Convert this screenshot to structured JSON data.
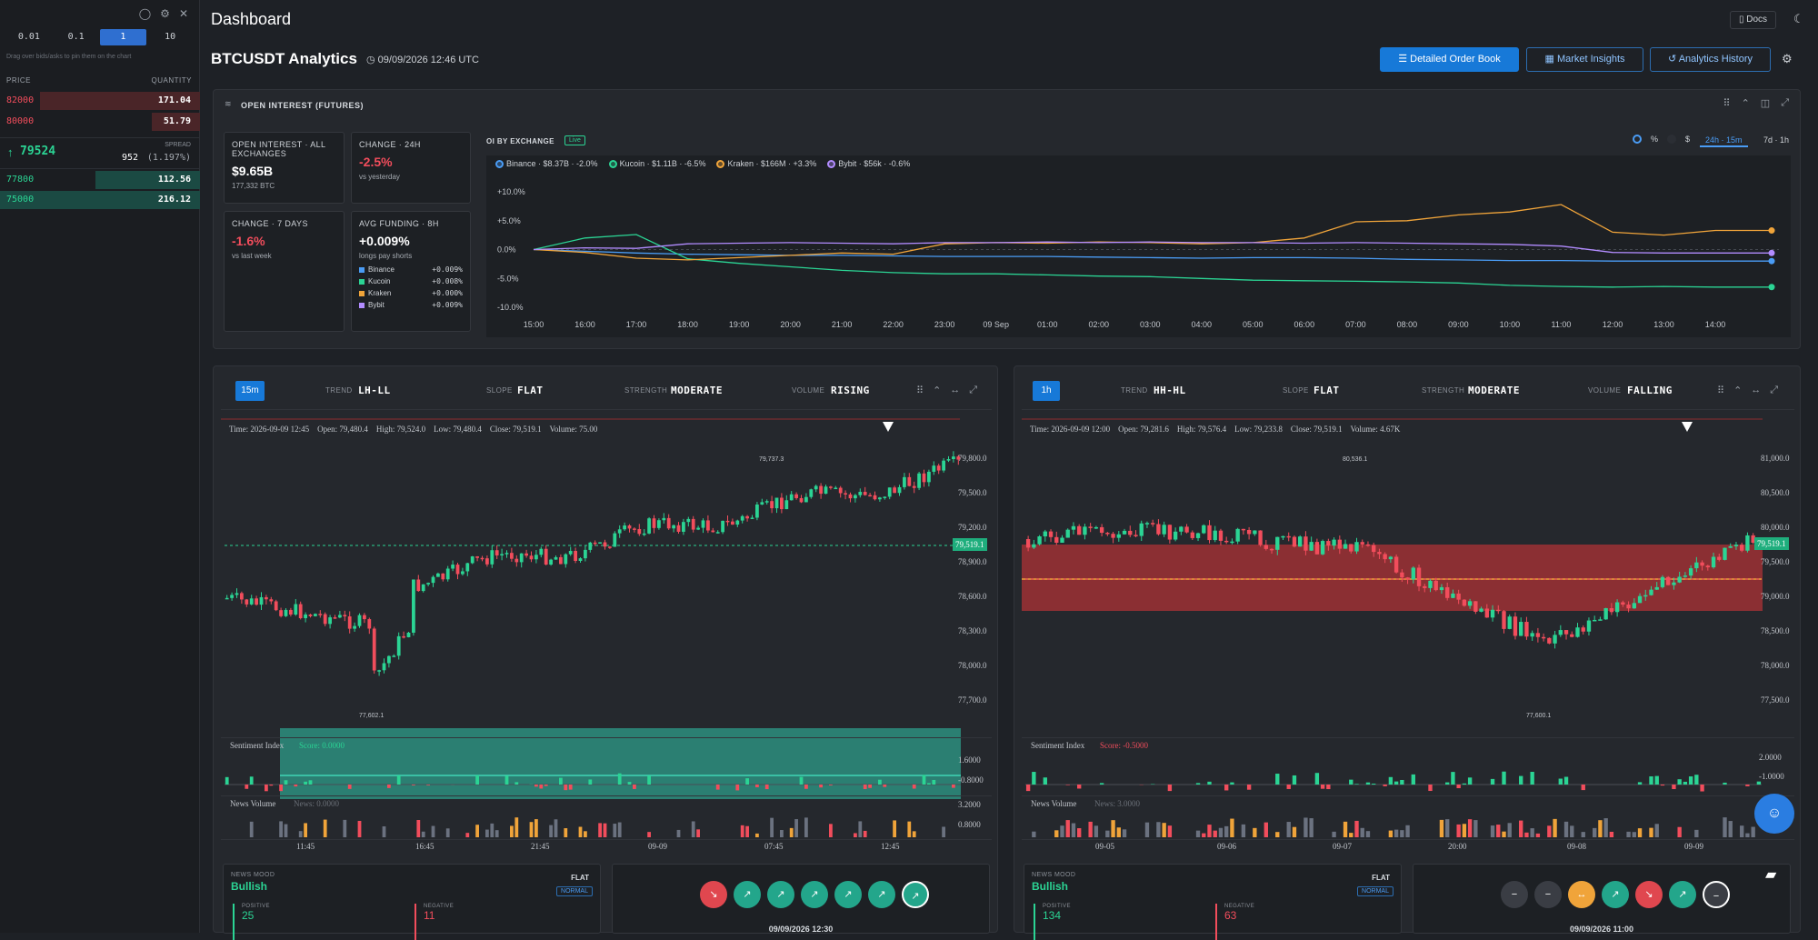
{
  "orderbook": {
    "steps": [
      "0.01",
      "0.1",
      "1",
      "10"
    ],
    "active_step": "1",
    "hint": "Drag over bids/asks to pin them on the chart",
    "price_header": "PRICE",
    "qty_header": "QUANTITY",
    "asks": [
      {
        "price": "82000",
        "qty": "171.04",
        "depth": 0.8
      },
      {
        "price": "80000",
        "qty": "51.79",
        "depth": 0.24
      }
    ],
    "mid": {
      "price": "79524",
      "spread_label": "SPREAD",
      "spread_val": "952",
      "spread_pct": "(1.197%)"
    },
    "bids": [
      {
        "price": "77800",
        "qty": "112.56",
        "depth": 0.52
      },
      {
        "price": "75000",
        "qty": "216.12",
        "depth": 1.0
      }
    ],
    "ask_color": "#f24d5c",
    "bid_color": "#2bd494"
  },
  "header": {
    "title": "Dashboard",
    "docs": "Docs",
    "page_title": "BTCUSDT Analytics",
    "timestamp": "09/09/2026 12:46 UTC",
    "buttons": [
      "Detailed Order Book",
      "Market Insights",
      "Analytics History"
    ]
  },
  "oi": {
    "panel_title": "OPEN INTEREST (FUTURES)",
    "total_label": "OPEN INTEREST · ALL EXCHANGES",
    "total_value": "$9.65B",
    "total_sub": "177,332 BTC",
    "change24_label": "CHANGE · 24H",
    "change24_value": "-2.5%",
    "change24_sub": "vs yesterday",
    "change7_label": "CHANGE · 7 DAYS",
    "change7_value": "-1.6%",
    "change7_sub": "vs last week",
    "funding_label": "AVG FUNDING · 8H",
    "funding_value": "+0.009%",
    "funding_sub": "longs pay shorts",
    "funding_rows": [
      {
        "name": "Binance",
        "value": "+0.009%",
        "color": "#4a9cf5"
      },
      {
        "name": "Kucoin",
        "value": "+0.008%",
        "color": "#2bd494"
      },
      {
        "name": "Kraken",
        "value": "+0.000%",
        "color": "#f0a43a"
      },
      {
        "name": "Bybit",
        "value": "+0.009%",
        "color": "#b28cff"
      }
    ],
    "by_exchange_label": "OI BY EXCHANGE",
    "live": "Live",
    "units": [
      "%",
      "$"
    ],
    "ranges": [
      "24h · 15m",
      "7d · 1h"
    ],
    "legend": [
      {
        "text": "Binance · $8.37B · -2.0%",
        "color": "#4a9cf5"
      },
      {
        "text": "Kucoin · $1.11B · -6.5%",
        "color": "#2bd494"
      },
      {
        "text": "Kraken · $166M · +3.3%",
        "color": "#f0a43a"
      },
      {
        "text": "Bybit · $56k · -0.6%",
        "color": "#b28cff"
      }
    ]
  },
  "chart_data": {
    "type": "line",
    "x": [
      "15:00",
      "16:00",
      "17:00",
      "18:00",
      "19:00",
      "20:00",
      "21:00",
      "22:00",
      "23:00",
      "09 Sep",
      "01:00",
      "02:00",
      "03:00",
      "04:00",
      "05:00",
      "06:00",
      "07:00",
      "08:00",
      "09:00",
      "10:00",
      "11:00",
      "12:00",
      "13:00",
      "14:00"
    ],
    "yticks": [
      "+10.0%",
      "+5.0%",
      "0.0%",
      "-5.0%",
      "-10.0%"
    ],
    "ylim": [
      -10,
      10
    ],
    "series": [
      {
        "name": "Binance",
        "color": "#4a9cf5",
        "values": [
          0,
          -0.3,
          -0.6,
          -0.8,
          -0.9,
          -1.0,
          -1.0,
          -1.1,
          -1.2,
          -1.2,
          -1.2,
          -1.3,
          -1.4,
          -1.5,
          -1.4,
          -1.4,
          -1.5,
          -1.7,
          -1.8,
          -1.9,
          -1.9,
          -2.0,
          -2.0,
          -2.0
        ]
      },
      {
        "name": "Kucoin",
        "color": "#2bd494",
        "values": [
          0,
          2.0,
          2.6,
          -1.6,
          -2.4,
          -3.0,
          -3.6,
          -4.0,
          -4.2,
          -4.2,
          -4.4,
          -4.6,
          -4.7,
          -5.0,
          -5.3,
          -5.4,
          -5.5,
          -5.6,
          -5.8,
          -6.2,
          -6.4,
          -6.5,
          -6.4,
          -6.5
        ]
      },
      {
        "name": "Kraken",
        "color": "#f0a43a",
        "values": [
          0,
          -0.5,
          -1.5,
          -1.8,
          -1.4,
          -1.0,
          -0.6,
          -0.8,
          1.0,
          1.2,
          1.1,
          1.3,
          1.2,
          1.0,
          1.2,
          2.0,
          4.8,
          5.0,
          6.0,
          6.5,
          7.8,
          3.0,
          2.5,
          3.3
        ]
      },
      {
        "name": "Bybit",
        "color": "#b28cff",
        "values": [
          0,
          0.3,
          0.2,
          1.0,
          1.1,
          1.2,
          1.1,
          1.0,
          1.2,
          1.2,
          1.3,
          1.2,
          1.3,
          1.2,
          1.2,
          1.1,
          1.2,
          1.1,
          1.0,
          0.9,
          0.6,
          -0.5,
          -0.6,
          -0.6
        ]
      }
    ]
  },
  "chart_left": {
    "interval": "15m",
    "trend_label": "TREND",
    "trend": "LH-LL",
    "slope_label": "SLOPE",
    "slope": "FLAT",
    "strength_label": "STRENGTH",
    "strength": "MODERATE",
    "volume_label": "VOLUME",
    "volume": "RISING",
    "ohlc": "Time: 2026-09-09 12:45    Open: 79,480.4    High: 79,524.0    Low: 79,480.4    Close: 79,519.1    Volume: 75.00",
    "price_ticks": [
      "79,800.0",
      "79,500.0",
      "79,200.0",
      "78,900.0",
      "78,600.0",
      "78,300.0",
      "78,000.0",
      "77,700.0"
    ],
    "last_price": "79,519.1",
    "high_label": "79,737.3",
    "low_label": "77,602.1",
    "sentiment_label": "Sentiment Index",
    "sentiment_score": "Score: 0.0000",
    "sentiment_ticks": [
      "1.6000",
      "-0.8000"
    ],
    "news_label": "News Volume",
    "news_score": "News: 0.0000",
    "news_ticks": [
      "3.2000",
      "0.8000"
    ],
    "time_ticks": [
      "11:45",
      "16:45",
      "21:45",
      "09-09",
      "07:45",
      "12:45"
    ]
  },
  "chart_right": {
    "interval": "1h",
    "trend_label": "TREND",
    "trend": "HH-HL",
    "slope_label": "SLOPE",
    "slope": "FLAT",
    "strength_label": "STRENGTH",
    "strength": "MODERATE",
    "volume_label": "VOLUME",
    "volume": "FALLING",
    "ohlc": "Time: 2026-09-09 12:00    Open: 79,281.6    High: 79,576.4    Low: 79,233.8    Close: 79,519.1    Volume: 4.67K",
    "price_ticks": [
      "81,000.0",
      "80,500.0",
      "80,000.0",
      "79,500.0",
      "79,000.0",
      "78,500.0",
      "78,000.0",
      "77,500.0"
    ],
    "last_price": "79,519.1",
    "high_label": "80,536.1",
    "low_label": "77,600.1",
    "sentiment_label": "Sentiment Index",
    "sentiment_score": "Score: -0.5000",
    "sentiment_ticks": [
      "2.0000",
      "-1.0000"
    ],
    "news_label": "News Volume",
    "news_score": "News: 3.0000",
    "news_ticks": [],
    "time_ticks": [
      "09-05",
      "09-06",
      "09-07",
      "20:00",
      "09-08",
      "09-09"
    ]
  },
  "mood_left": {
    "label": "NEWS MOOD",
    "value": "Bullish",
    "flat": "FLAT",
    "badge": "NORMAL",
    "pos_label": "POSITIVE",
    "neg_label": "NEGATIVE",
    "pos_val": "25",
    "neg_val": "11",
    "timeline_time": "09/09/2026 12:30"
  },
  "mood_right": {
    "label": "NEWS MOOD",
    "value": "Bullish",
    "flat": "FLAT",
    "badge": "NORMAL",
    "pos_label": "POSITIVE",
    "neg_label": "NEGATIVE",
    "pos_val": "134",
    "neg_val": "63",
    "timeline_time": "09/09/2026 11:00"
  }
}
